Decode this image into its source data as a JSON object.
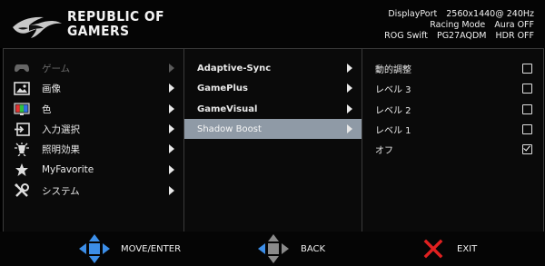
{
  "header": {
    "brand_line1": "REPUBLIC OF",
    "brand_line2": "GAMERS",
    "input": "DisplayPort",
    "resolution": "2560x1440@ 240Hz",
    "mode": "Racing Mode",
    "aura": "Aura OFF",
    "model_prefix": "ROG Swift",
    "model": "PG27AQDM",
    "hdr": "HDR OFF"
  },
  "main_menu": [
    {
      "label": "ゲーム",
      "icon": "gamepad-icon",
      "active": false
    },
    {
      "label": "画像",
      "icon": "image-icon",
      "active": true
    },
    {
      "label": "色",
      "icon": "color-icon",
      "active": true
    },
    {
      "label": "入力選択",
      "icon": "input-select-icon",
      "active": true
    },
    {
      "label": "照明効果",
      "icon": "lighting-icon",
      "active": true
    },
    {
      "label": "MyFavorite",
      "icon": "star-icon",
      "active": true
    },
    {
      "label": "システム",
      "icon": "tools-icon",
      "active": true
    }
  ],
  "sub_menu": [
    {
      "label": "Adaptive-Sync",
      "selected": false
    },
    {
      "label": "GamePlus",
      "selected": false
    },
    {
      "label": "GameVisual",
      "selected": false
    },
    {
      "label": "Shadow Boost",
      "selected": true
    }
  ],
  "options": [
    {
      "label": "動的調整",
      "checked": false
    },
    {
      "label": "レベル 3",
      "checked": false
    },
    {
      "label": "レベル 2",
      "checked": false
    },
    {
      "label": "レベル 1",
      "checked": false
    },
    {
      "label": "オフ",
      "checked": true
    }
  ],
  "footer": {
    "move_label": "MOVE/ENTER",
    "back_label": "BACK",
    "exit_label": "EXIT"
  },
  "colors": {
    "dpad_blue": "#3c8ee8",
    "dpad_grey": "#8a8a8a",
    "exit_red": "#e02020",
    "selection": "#8f9aa6"
  }
}
